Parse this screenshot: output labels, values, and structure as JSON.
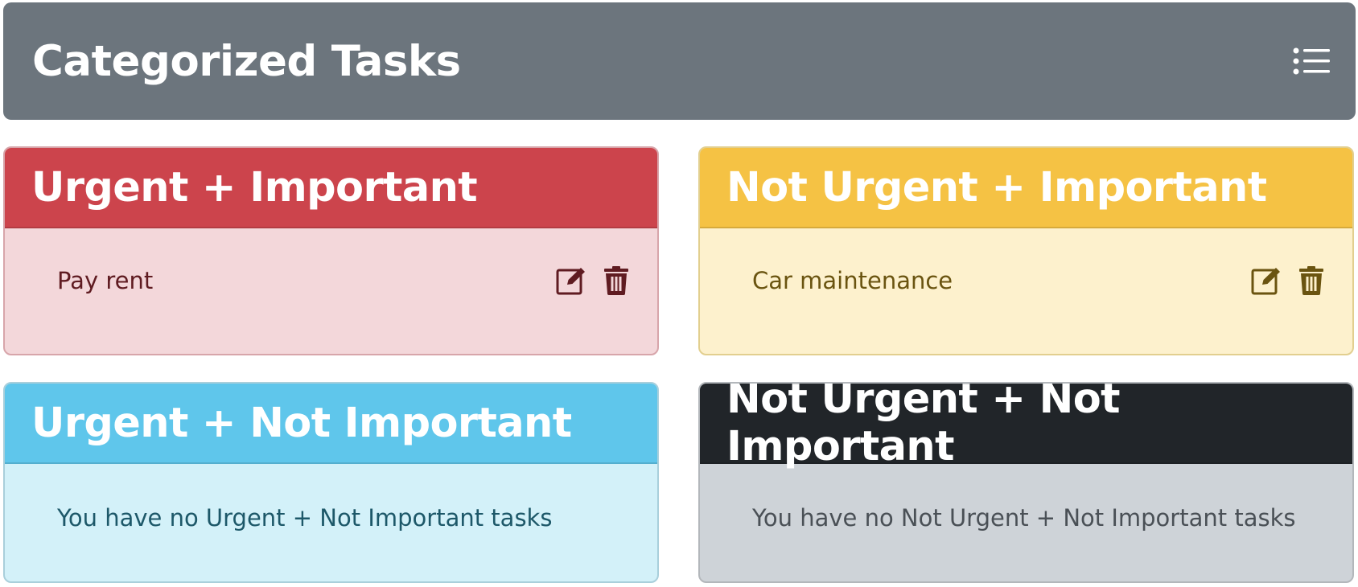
{
  "header": {
    "title": "Categorized Tasks",
    "menu_icon": "list-icon",
    "background": "#6c757d"
  },
  "quadrants": [
    {
      "title": "Urgent + Important",
      "color": "#cc444c",
      "tasks": [
        {
          "label": "Pay rent",
          "actions": [
            "edit-icon",
            "trash-icon"
          ]
        }
      ]
    },
    {
      "title": "Not Urgent + Important",
      "color": "#f5c244",
      "tasks": [
        {
          "label": "Car maintenance",
          "actions": [
            "edit-icon",
            "trash-icon"
          ]
        }
      ]
    },
    {
      "title": "Urgent + Not Important",
      "color": "#5fc6eb",
      "tasks": [],
      "empty_message": "You have no Urgent + Not Important tasks"
    },
    {
      "title": "Not Urgent + Not Important",
      "color": "#212529",
      "tasks": [],
      "empty_message": "You have no Not Urgent + Not Important tasks"
    }
  ]
}
